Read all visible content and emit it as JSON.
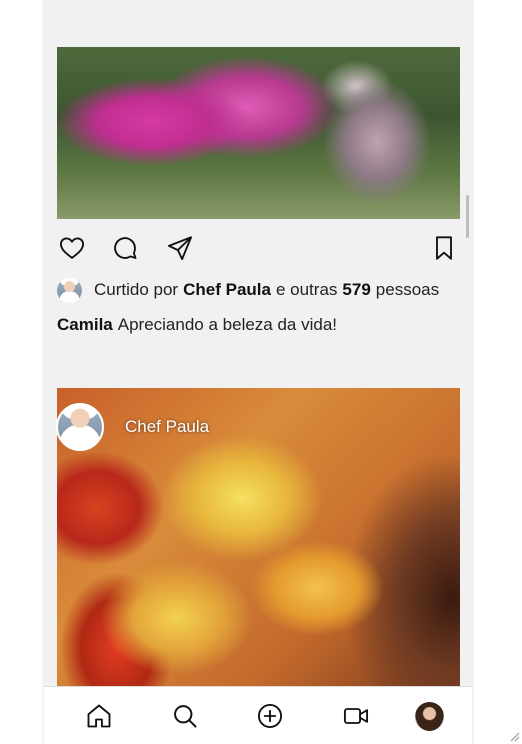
{
  "post1": {
    "image_alt": "pink-flower-photo",
    "liked_by": {
      "prefix": "Curtido por",
      "user": "Chef Paula",
      "middle": "e outras",
      "count": "579",
      "suffix": "pessoas"
    },
    "caption": {
      "user": "Camila",
      "text": "Apreciando a beleza da vida!"
    }
  },
  "post2": {
    "author": "Chef Paula",
    "image_alt": "salad-bowl-photo"
  },
  "icons": {
    "like": "heart-icon",
    "comment": "comment-icon",
    "share": "send-icon",
    "save": "bookmark-icon"
  },
  "nav": {
    "items": [
      "home-icon",
      "search-icon",
      "add-icon",
      "video-icon",
      "profile-avatar"
    ]
  },
  "colors": {
    "background": "#f1f1f1",
    "nav_background": "#ffffff",
    "text": "#222222"
  }
}
